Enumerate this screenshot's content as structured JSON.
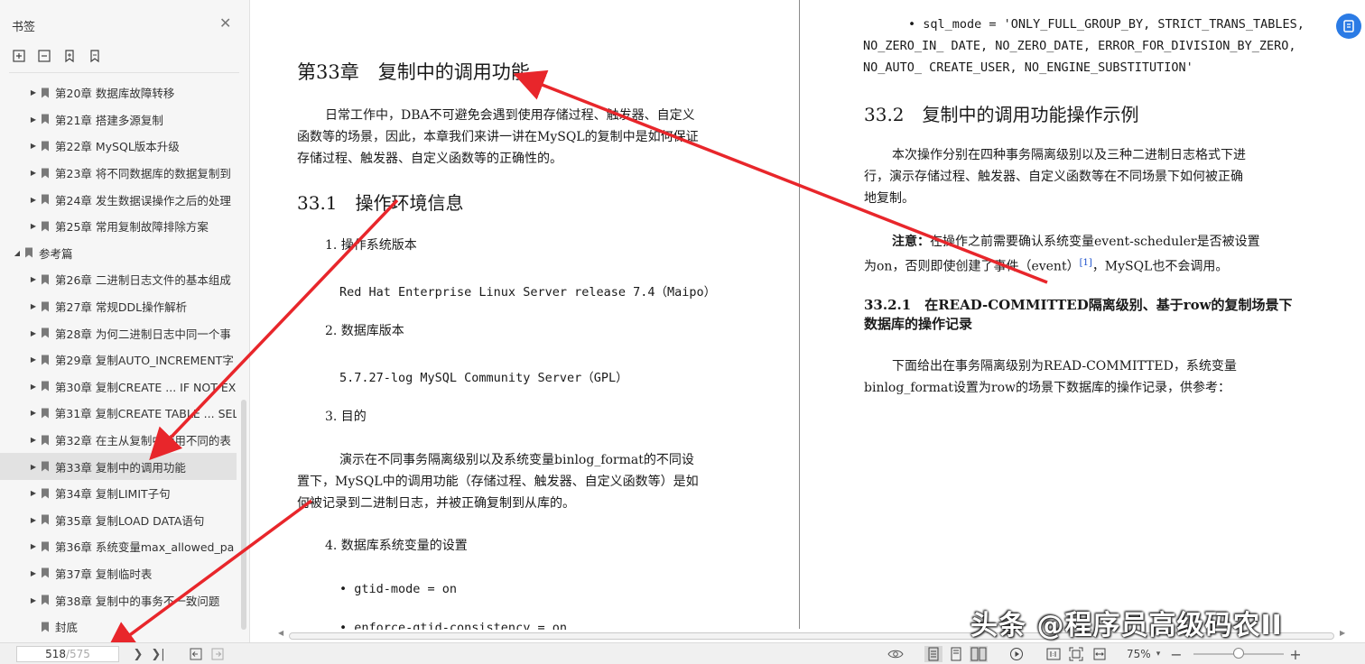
{
  "sidebar": {
    "title": "书签",
    "items": [
      {
        "label": "第20章 数据库故障转移",
        "arrow": true,
        "level": 1
      },
      {
        "label": "第21章 搭建多源复制",
        "arrow": true,
        "level": 1
      },
      {
        "label": "第22章 MySQL版本升级",
        "arrow": true,
        "level": 1
      },
      {
        "label": "第23章 将不同数据库的数据复制到",
        "arrow": true,
        "level": 1
      },
      {
        "label": "第24章 发生数据误操作之后的处理",
        "arrow": true,
        "level": 1
      },
      {
        "label": "第25章 常用复制故障排除方案",
        "arrow": true,
        "level": 1
      },
      {
        "label": "参考篇",
        "arrow": true,
        "level": 0,
        "expanded": true
      },
      {
        "label": "第26章 二进制日志文件的基本组成",
        "arrow": true,
        "level": 1
      },
      {
        "label": "第27章 常规DDL操作解析",
        "arrow": true,
        "level": 1
      },
      {
        "label": "第28章 为何二进制日志中同一个事",
        "arrow": true,
        "level": 1
      },
      {
        "label": "第29章 复制AUTO_INCREMENT字",
        "arrow": true,
        "level": 1
      },
      {
        "label": "第30章 复制CREATE ... IF NOT EX",
        "arrow": true,
        "level": 1
      },
      {
        "label": "第31章 复制CREATE TABLE ... SEL",
        "arrow": true,
        "level": 1
      },
      {
        "label": "第32章 在主从复制中使用不同的表",
        "arrow": true,
        "level": 1
      },
      {
        "label": "第33章 复制中的调用功能",
        "arrow": true,
        "level": 1,
        "active": true
      },
      {
        "label": "第34章 复制LIMIT子句",
        "arrow": true,
        "level": 1
      },
      {
        "label": "第35章 复制LOAD DATA语句",
        "arrow": true,
        "level": 1
      },
      {
        "label": "第36章 系统变量max_allowed_pa",
        "arrow": true,
        "level": 1
      },
      {
        "label": "第37章 复制临时表",
        "arrow": true,
        "level": 1
      },
      {
        "label": "第38章 复制中的事务不一致问题",
        "arrow": true,
        "level": 1
      },
      {
        "label": "封底",
        "arrow": false,
        "level": 1
      }
    ]
  },
  "left_page": {
    "chapter_title": "第33章　复制中的调用功能",
    "intro": [
      "日常工作中，DBA不可避免会遇到使用存储过程、触发器、自定义",
      "函数等的场景，因此，本章我们来讲一讲在MySQL的复制中是如何保证",
      "存储过程、触发器、自定义函数等的正确性的。"
    ],
    "section_title": "33.1　操作环境信息",
    "item1": "1. 操作系统版本",
    "item1_val": "Red Hat Enterprise Linux Server release 7.4（Maipo）",
    "item2": "2. 数据库版本",
    "item2_val": "5.7.27-log MySQL Community Server（GPL）",
    "item3": "3. 目的",
    "item3_text": [
      "演示在不同事务隔离级别以及系统变量binlog_format的不同设",
      "置下，MySQL中的调用功能（存储过程、触发器、自定义函数等）是如",
      "何被记录到二进制日志，并被正确复制到从库的。"
    ],
    "item4": "4. 数据库系统变量的设置",
    "bullet1": "• gtid-mode = on",
    "bullet2_partial": "• enforce-gtid-consistency = on"
  },
  "right_page": {
    "sql_mode_lines": [
      "• sql_mode = 'ONLY_FULL_GROUP_BY, STRICT_TRANS_TABLES,",
      "NO_ZERO_IN_ DATE, NO_ZERO_DATE, ERROR_FOR_DIVISION_BY_ZERO,",
      "NO_AUTO_ CREATE_USER, NO_ENGINE_SUBSTITUTION'"
    ],
    "section_title": "33.2　复制中的调用功能操作示例",
    "para1": [
      "本次操作分别在四种事务隔离级别以及三种二进制日志格式下进",
      "行，演示存储过程、触发器、自定义函数等在不同场景下如何被正确",
      "地复制。"
    ],
    "note_label": "注意：",
    "note_line1": "在操作之前需要确认系统变量event-scheduler是否被设置",
    "note_line2_a": "为on，否则即使创建了事件（event）",
    "note_footnote": "[1]",
    "note_line2_b": "，MySQL也不会调用。",
    "subsection_title": [
      "33.2.1　在READ-COMMITTED隔离级别、基于row的复制场景下",
      "数据库的操作记录"
    ],
    "para2": [
      "下面给出在事务隔离级别为READ-COMMITTED，系统变量",
      "binlog_format设置为row的场景下数据库的操作记录，供参考："
    ]
  },
  "statusbar": {
    "current_page": "518",
    "total_pages": "/575",
    "zoom": "75%"
  },
  "watermark": "头条 @程序员高级码农II",
  "colors": {
    "arrow": "#e8262b",
    "accent": "#2b7be5",
    "active_bookmark": "#e2e2e2"
  }
}
